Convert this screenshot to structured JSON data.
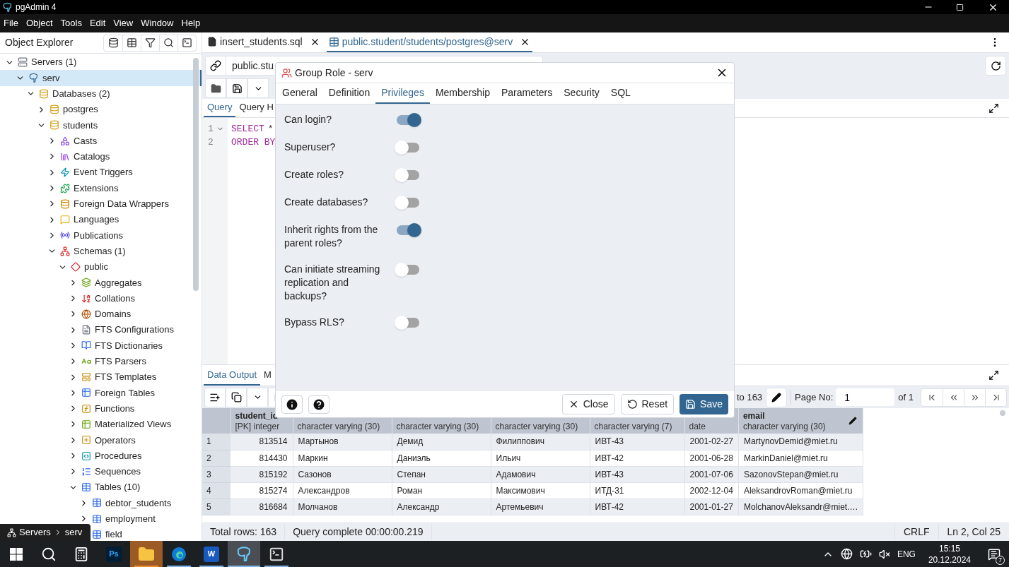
{
  "window": {
    "title": "pgAdmin 4"
  },
  "menu": [
    "File",
    "Object",
    "Tools",
    "Edit",
    "View",
    "Window",
    "Help"
  ],
  "object_explorer": {
    "title": "Object Explorer",
    "tree": [
      {
        "label": "Servers (1)",
        "kind": "server-group",
        "expanded": true,
        "selected": false,
        "children": [
          {
            "label": "serv",
            "kind": "server",
            "expanded": true,
            "selected": true,
            "children": [
              {
                "label": "Databases (2)",
                "kind": "database",
                "expanded": true,
                "selected": false,
                "children": [
                  {
                    "label": "postgres",
                    "kind": "database",
                    "expanded": false,
                    "selected": false
                  },
                  {
                    "label": "students",
                    "kind": "database",
                    "expanded": true,
                    "selected": false,
                    "children": [
                      {
                        "label": "Casts",
                        "kind": "casts",
                        "expanded": false,
                        "selected": false
                      },
                      {
                        "label": "Catalogs",
                        "kind": "catalogs",
                        "expanded": false,
                        "selected": false
                      },
                      {
                        "label": "Event Triggers",
                        "kind": "triggers",
                        "expanded": false,
                        "selected": false
                      },
                      {
                        "label": "Extensions",
                        "kind": "extensions",
                        "expanded": false,
                        "selected": false
                      },
                      {
                        "label": "Foreign Data Wrappers",
                        "kind": "fdw",
                        "expanded": false,
                        "selected": false
                      },
                      {
                        "label": "Languages",
                        "kind": "languages",
                        "expanded": false,
                        "selected": false
                      },
                      {
                        "label": "Publications",
                        "kind": "publications",
                        "expanded": false,
                        "selected": false
                      },
                      {
                        "label": "Schemas (1)",
                        "kind": "schemas",
                        "expanded": true,
                        "selected": false,
                        "children": [
                          {
                            "label": "public",
                            "kind": "schema",
                            "expanded": true,
                            "selected": false,
                            "children": [
                              {
                                "label": "Aggregates",
                                "kind": "aggregates",
                                "expanded": false,
                                "selected": false
                              },
                              {
                                "label": "Collations",
                                "kind": "collations",
                                "expanded": false,
                                "selected": false
                              },
                              {
                                "label": "Domains",
                                "kind": "domains",
                                "expanded": false,
                                "selected": false
                              },
                              {
                                "label": "FTS Configurations",
                                "kind": "fts-config",
                                "expanded": false,
                                "selected": false
                              },
                              {
                                "label": "FTS Dictionaries",
                                "kind": "fts-dict",
                                "expanded": false,
                                "selected": false
                              },
                              {
                                "label": "FTS Parsers",
                                "kind": "fts-parser",
                                "expanded": false,
                                "selected": false
                              },
                              {
                                "label": "FTS Templates",
                                "kind": "fts-template",
                                "expanded": false,
                                "selected": false
                              },
                              {
                                "label": "Foreign Tables",
                                "kind": "foreign-tables",
                                "expanded": false,
                                "selected": false
                              },
                              {
                                "label": "Functions",
                                "kind": "functions",
                                "expanded": false,
                                "selected": false
                              },
                              {
                                "label": "Materialized Views",
                                "kind": "mviews",
                                "expanded": false,
                                "selected": false
                              },
                              {
                                "label": "Operators",
                                "kind": "operators",
                                "expanded": false,
                                "selected": false
                              },
                              {
                                "label": "Procedures",
                                "kind": "procedures",
                                "expanded": false,
                                "selected": false
                              },
                              {
                                "label": "Sequences",
                                "kind": "sequences",
                                "expanded": false,
                                "selected": false
                              },
                              {
                                "label": "Tables (10)",
                                "kind": "tables",
                                "expanded": true,
                                "selected": false,
                                "children": [
                                  {
                                    "label": "debtor_students",
                                    "kind": "table",
                                    "expanded": false,
                                    "selected": false
                                  },
                                  {
                                    "label": "employment",
                                    "kind": "table",
                                    "expanded": false,
                                    "selected": false
                                  },
                                  {
                                    "label": "field",
                                    "kind": "table",
                                    "expanded": false,
                                    "selected": false
                                  }
                                ]
                              }
                            ]
                          }
                        ]
                      }
                    ]
                  }
                ]
              }
            ]
          }
        ]
      }
    ],
    "breadcrumb": [
      "Servers",
      "serv"
    ]
  },
  "editor_tabs": [
    {
      "label": "insert_students.sql",
      "kind": "file",
      "selected": false
    },
    {
      "label": "public.student/students/postgres@serv",
      "kind": "table",
      "selected": true
    }
  ],
  "connection": {
    "value": "public.stu"
  },
  "query_tabs": [
    {
      "label": "Query",
      "selected": true
    },
    {
      "label": "Query H",
      "selected": false
    }
  ],
  "code_lines": [
    {
      "number": "1",
      "foldable": true,
      "tokens": [
        {
          "text": "SELECT",
          "kind": "keyword"
        },
        {
          "text": "*",
          "kind": "operator"
        }
      ]
    },
    {
      "number": "2",
      "foldable": false,
      "tokens": [
        {
          "text": "ORDER BY",
          "kind": "keyword"
        }
      ]
    }
  ],
  "output_tabs": [
    {
      "label": "Data Output",
      "selected": true
    },
    {
      "label": "M",
      "selected": false
    }
  ],
  "pager": {
    "rows_text": "to 163",
    "page_label": "Page No:",
    "page": "1",
    "of_text": "of 1"
  },
  "table": {
    "columns": [
      {
        "name": "student_id",
        "type": "[PK] integer"
      },
      {
        "type": "character varying (30)"
      },
      {
        "type": "character varying (30)"
      },
      {
        "type": "character varying (30)"
      },
      {
        "type": "character varying (7)"
      },
      {
        "type": "date"
      },
      {
        "name": "email",
        "type": "character varying (30)"
      }
    ],
    "rows": [
      {
        "number": "1",
        "cells": [
          "813514",
          "Мартынов",
          "Демид",
          "Филиппович",
          "ИВТ-43",
          "2001-02-27",
          "MartynovDemid@miet.ru"
        ]
      },
      {
        "number": "2",
        "cells": [
          "814430",
          "Маркин",
          "Даниэль",
          "Ильич",
          "ИВТ-42",
          "2001-06-28",
          "MarkinDaniel@miet.ru"
        ]
      },
      {
        "number": "3",
        "cells": [
          "815192",
          "Сазонов",
          "Степан",
          "Адамович",
          "ИВТ-43",
          "2001-07-06",
          "SazonovStepan@miet.ru"
        ]
      },
      {
        "number": "4",
        "cells": [
          "815274",
          "Александров",
          "Роман",
          "Максимович",
          "ИТД-31",
          "2002-12-04",
          "AleksandrovRoman@miet.ru"
        ]
      },
      {
        "number": "5",
        "cells": [
          "816684",
          "Молчанов",
          "Александр",
          "Артемьевич",
          "ИВТ-42",
          "2001-01-27",
          "MolchanovAleksandr@miet.…"
        ]
      }
    ]
  },
  "status_bar": {
    "left": [
      "Total rows: 163",
      "Query complete 00:00:00.219"
    ],
    "right": [
      "CRLF",
      "Ln 2, Col 25"
    ]
  },
  "dialog": {
    "title": "Group Role - serv",
    "tabs": [
      {
        "label": "General",
        "selected": false
      },
      {
        "label": "Definition",
        "selected": false
      },
      {
        "label": "Privileges",
        "selected": true
      },
      {
        "label": "Membership",
        "selected": false
      },
      {
        "label": "Parameters",
        "selected": false
      },
      {
        "label": "Security",
        "selected": false
      },
      {
        "label": "SQL",
        "selected": false
      }
    ],
    "privileges": [
      {
        "label": "Can login?",
        "on": true
      },
      {
        "label": "Superuser?",
        "on": false
      },
      {
        "label": "Create roles?",
        "on": false
      },
      {
        "label": "Create databases?",
        "on": false
      },
      {
        "label": "Inherit rights from the parent roles?",
        "on": true
      },
      {
        "label": "Can initiate streaming replication and backups?",
        "on": false
      },
      {
        "label": "Bypass RLS?",
        "on": false
      }
    ],
    "buttons": [
      {
        "label": "Close",
        "kind": "close"
      },
      {
        "label": "Reset",
        "kind": "reset"
      },
      {
        "label": "Save",
        "kind": "save"
      }
    ]
  },
  "taskbar": {
    "apps": [
      {
        "kind": "start"
      },
      {
        "kind": "search"
      },
      {
        "kind": "calculator",
        "open": false,
        "focused": false,
        "flashing": false
      },
      {
        "kind": "photoshop",
        "label": "Ps",
        "open": false,
        "focused": false,
        "flashing": false
      },
      {
        "kind": "explorer",
        "open": true,
        "focused": false,
        "flashing": true
      },
      {
        "kind": "edge",
        "open": true,
        "focused": false,
        "flashing": false
      },
      {
        "kind": "word",
        "label": "W",
        "open": true,
        "focused": false,
        "flashing": false
      },
      {
        "kind": "pgadmin",
        "open": true,
        "focused": true,
        "flashing": false
      },
      {
        "kind": "terminal",
        "open": true,
        "focused": false,
        "flashing": false
      }
    ],
    "tray": {
      "language": "ENG",
      "time": "15:15",
      "date": "20.12.2024",
      "notifications": "7"
    }
  }
}
